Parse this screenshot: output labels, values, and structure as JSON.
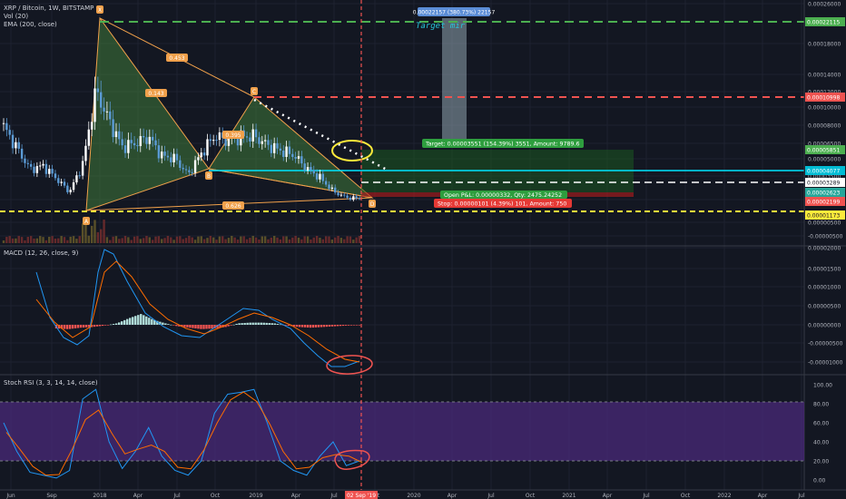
{
  "legend": {
    "main_title": "XRP / Bitcoin, 1W, BITSTAMP",
    "volume": "Vol (20)",
    "ema": "EMA (200, close)",
    "macd": "MACD (12, 26, close, 9)",
    "stoch": "Stoch RSI (3, 3, 14, 14, close)"
  },
  "colors": {
    "background": "#131722",
    "grid": "#1e2230",
    "up_candle": "#26a69a",
    "down_candle": "#5b9bd5",
    "pattern_fill": "#3f7a3a",
    "pattern_line": "#f0a04b",
    "cyan_line": "#00e5ff",
    "green_dash": "#4caf50",
    "red_dash": "#ef5350",
    "yellow_dash": "#ffeb3b",
    "macd_line": "#2196f3",
    "signal_line": "#ff6d00",
    "hist_up": "#b2dfdb",
    "hist_down": "#ef5350",
    "rsi_band": "#4a2a7a",
    "k_line": "#2196f3",
    "d_line": "#ff6d00"
  },
  "price_axis": [
    "0.00026000",
    "0.00018000",
    "0.00014000",
    "0.00012000",
    "0.00010000",
    "0.00008000",
    "0.00006500",
    "0.00005000",
    "0.00003500",
    "0.00002000",
    "0.00000500",
    "-0.00000500"
  ],
  "price_badges": [
    {
      "label": "0.00022115",
      "color": "#4caf50"
    },
    {
      "label": "0.00010998",
      "color": "#ef5350"
    },
    {
      "label": "0.00005851",
      "color": "#4caf50"
    },
    {
      "label": "0.00004077",
      "color": "#00bcd4"
    },
    {
      "label": "0.00003289",
      "color": "#ffffff"
    },
    {
      "label": "0.00002623",
      "color": "#26a69a"
    },
    {
      "label": "0.00002199",
      "color": "#ef5350"
    },
    {
      "label": "0.00001173",
      "color": "#ffeb3b"
    }
  ],
  "macd_axis": [
    "0.00002000",
    "0.00001500",
    "0.00001000",
    "0.00000500",
    "0.00000000",
    "-0.00000500",
    "-0.00001000"
  ],
  "rsi_axis": [
    "100.00",
    "80.00",
    "60.00",
    "40.00",
    "20.00",
    "0.00"
  ],
  "time_axis": [
    "Jun",
    "Sep",
    "2018",
    "Apr",
    "Jul",
    "Oct",
    "2019",
    "Apr",
    "Jul",
    "Oct",
    "2020",
    "Apr",
    "Jul",
    "Oct",
    "2021",
    "Apr",
    "Jul",
    "Oct",
    "2022",
    "Apr",
    "Jul"
  ],
  "time_cursor_label": "02 Sep '19",
  "pattern_labels": {
    "X": "X",
    "A": "A",
    "B": "B",
    "C": "C",
    "D": "D",
    "r1": "0.453",
    "r2": "0.143",
    "r3": "0.395",
    "r4": "0.626"
  },
  "target_label": "Target mir",
  "measure_label": "0.00022157 (380.73%) 22157",
  "position": {
    "target": "Target: 0.00003551 (154.39%) 3551, Amount: 9789.6",
    "open_pnl": "Open P&L: 0.00000332, Qty: 2475.24252",
    "stop": "Stop: 0.00000101 (4.39%) 101, Amount: 750"
  },
  "chart_data": [
    {
      "type": "line",
      "title": "XRP / Bitcoin, 1W, BITSTAMP",
      "series": [
        {
          "name": "XRP / Bitcoin",
          "x": [
            "2017-06",
            "2017-07",
            "2017-08",
            "2017-09",
            "2017-10",
            "2017-11",
            "2017-12",
            "2018-01",
            "2018-02",
            "2018-03",
            "2018-04",
            "2018-05",
            "2018-06",
            "2018-07",
            "2018-08",
            "2018-09",
            "2018-10",
            "2018-11",
            "2018-12",
            "2019-01",
            "2019-02",
            "2019-03",
            "2019-04",
            "2019-05",
            "2019-06",
            "2019-07",
            "2019-08",
            "2019-09"
          ],
          "values": [
            0.000105,
            8.2e-05,
            5.8e-05,
            6.2e-05,
            4.8e-05,
            3.3e-05,
            6.4e-05,
            0.000145,
            0.000112,
            8.3e-05,
            8.7e-05,
            9.4e-05,
            7.3e-05,
            7e-05,
            5.2e-05,
            7.6e-05,
            9.5e-05,
            9e-05,
            9.4e-05,
            9.5e-05,
            8.5e-05,
            7.9e-05,
            7.4e-05,
            5.9e-05,
            4.9e-05,
            3.4e-05,
            2.7e-05,
            2.6e-05
          ]
        }
      ]
    },
    {
      "type": "bar",
      "title": "MACD (12, 26, close, 9)",
      "series": [
        {
          "name": "histogram",
          "values": [
            -1e-06,
            -1.2e-06,
            -8e-07,
            -6e-07,
            -2e-07,
            4e-07,
            1.8e-06,
            3e-06,
            1.4e-06,
            4e-07,
            -4e-07,
            -8e-07,
            -1.2e-06,
            -1e-06,
            -6e-07,
            4e-07,
            6e-07,
            6e-07,
            4e-07,
            -2e-07,
            -6e-07,
            -8e-07,
            -6e-07,
            -4e-07,
            -2e-07,
            -1e-07
          ]
        }
      ]
    },
    {
      "type": "line",
      "title": "Stoch RSI (3, 3, 14, 14, close)",
      "ylim": [
        0,
        100
      ],
      "series": [
        {
          "name": "K",
          "values": [
            60,
            30,
            8,
            5,
            2,
            10,
            85,
            95,
            40,
            12,
            30,
            55,
            25,
            10,
            5,
            20,
            70,
            90,
            92,
            95,
            60,
            20,
            10,
            5,
            25,
            40,
            15,
            20
          ]
        }
      ]
    }
  ]
}
